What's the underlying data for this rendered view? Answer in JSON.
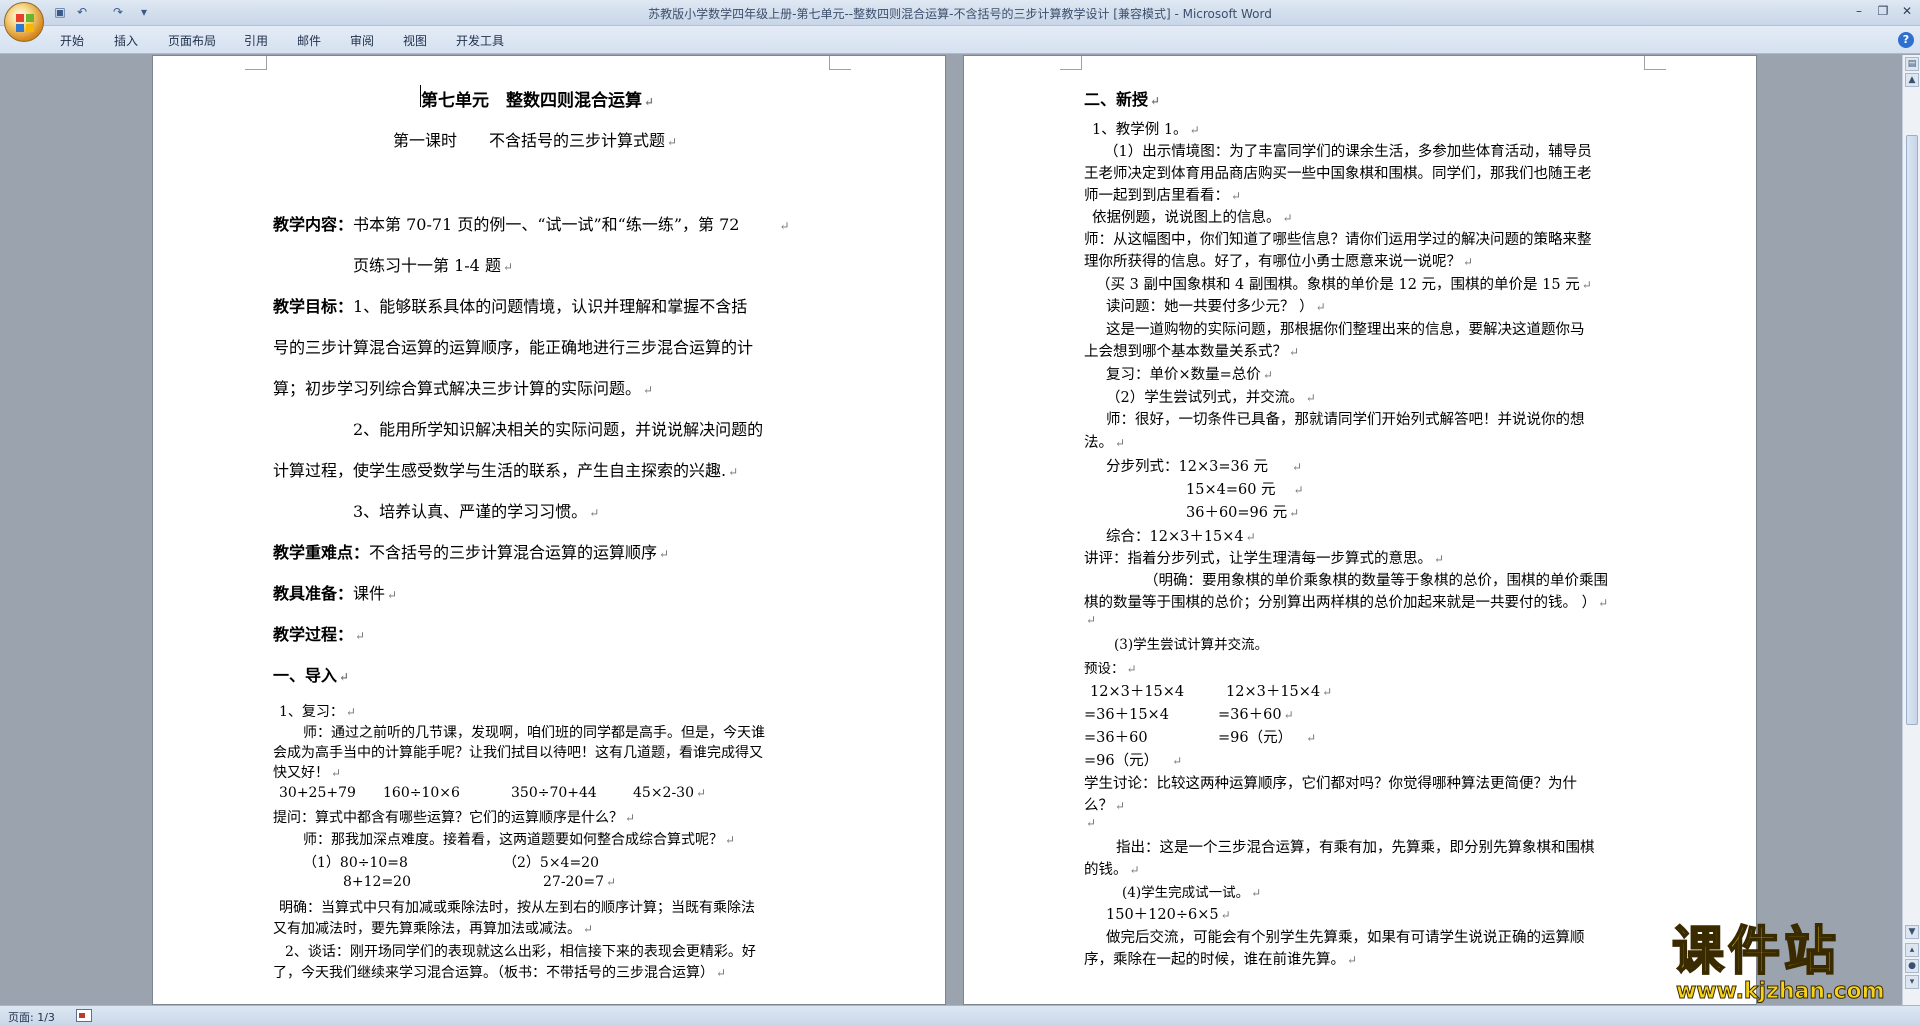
{
  "window": {
    "title": "苏教版小学数学四年级上册-第七单元--整数四则混合运算-不含括号的三步计算教学设计 [兼容模式] - Microsoft Word",
    "minimize": "–",
    "restore": "❐",
    "close": "✕"
  },
  "quick_access": {
    "save": "▣",
    "undo": "↶",
    "redo": "↷",
    "customize": "▾"
  },
  "ribbon": {
    "tabs": [
      "开始",
      "插入",
      "页面布局",
      "引用",
      "邮件",
      "审阅",
      "视图",
      "开发工具"
    ],
    "help": "?"
  },
  "page1": {
    "title": "第七单元　整数四则混合运算",
    "subtitle": "第一课时　　不含括号的三步计算式题",
    "content_label": "教学内容：",
    "content_text": "书本第 70-71 页的例一、“试一试”和“练一练”，第 72",
    "content_text2": "页练习十一第 1-4 题",
    "goal_label": "教学目标：",
    "goal_1a": "1、能够联系具体的问题情境，认识并理解和掌握不含括",
    "goal_1b": "号的三步计算混合运算的运算顺序，能正确地进行三步混合运算的计",
    "goal_1c": "算；初步学习列综合算式解决三步计算的实际问题。",
    "goal_2a": "2、能用所学知识解决相关的实际问题，并说说解决问题的",
    "goal_2b": "计算过程，使学生感受数学与生活的联系，产生自主探索的兴趣.",
    "goal_3": "3、培养认真、严谨的学习习惯。",
    "key_label": "教学重难点：",
    "key_text": "不含括号的三步计算混合运算的运算顺序",
    "prep_label": "教具准备：",
    "prep_text": "课件",
    "process_label": "教学过程：",
    "section1": "一、导入",
    "review": "1、复习：",
    "teacher1a": "师：通过之前听的几节课，发现啊，咱们班的同学都是高手。但是，今天谁",
    "teacher1b": "会成为高手当中的计算能手呢？让我们拭目以待吧！这有几道题，看谁完成得又",
    "teacher1c": "快又好！",
    "exercises": [
      "30+25+79",
      "160÷10×6",
      "350÷70+44",
      "45×2-30"
    ],
    "question": "提问：算式中都含有哪些运算？它们的运算顺序是什么？",
    "teacher2": "师：那我加深点难度。接着看，这两道题要如何整合成综合算式呢？",
    "combo_1a": "（1）80÷10=8",
    "combo_2a": "（2）5×4=20",
    "combo_1b": "8+12=20",
    "combo_2b": "27-20=7",
    "clarify_a": "明确：当算式中只有加减或乘除法时，按从左到右的顺序计算；当既有乘除法",
    "clarify_b": "又有加减法时，要先算乘除法，再算加法或减法。",
    "talk_a": "2、谈话：刚开场同学们的表现就这么出彩，相信接下来的表现会更精彩。好",
    "talk_b": "了，今天我们继续来学习混合运算。（板书：不带括号的三步混合运算）"
  },
  "page2": {
    "section2": "二、新授",
    "example": "1、教学例 1。",
    "l1": "（1）出示情境图：为了丰富同学们的课余生活，多参加些体育活动，辅导员",
    "l2": "王老师决定到体育用品商店购买一些中国象棋和围棋。同学们，那我们也随王老",
    "l3": "师一起到到店里看看：",
    "l4": "依据例题，说说图上的信息。",
    "l5": "师：从这幅图中，你们知道了哪些信息？请你们运用学过的解决问题的策略来整",
    "l6": "理你所获得的信息。好了，有哪位小勇士愿意来说一说呢？",
    "l7": "（买 3 副中国象棋和 4 副围棋。象棋的单价是 12 元，围棋的单价是 15 元",
    "l8": "读问题：她一共要付多少元？ ）",
    "l9": "这是一道购物的实际问题，那根据你们整理出来的信息，要解决这道题你马",
    "l10": "上会想到哪个基本数量关系式？",
    "l11": "复习：单价×数量=总价",
    "l12": "（2）学生尝试列式，并交流。",
    "l13": "师：很好，一切条件已具备，那就请同学们开始列式解答吧！并说说你的想",
    "l14": "法。",
    "l15": "分步列式：12×3=36 元",
    "l16": "15×4=60 元",
    "l17": "36＋60=96 元",
    "l18": "综合：12×3＋15×4",
    "l19": "讲评：指着分步列式，让学生理清每一步算式的意思。",
    "l20": "（明确：要用象棋的单价乘象棋的数量等于象棋的总价，围棋的单价乘围",
    "l21": "棋的数量等于围棋的总价；分别算出两样棋的总价加起来就是一共要付的钱。 ）",
    "l22": "(3)学生尝试计算并交流。",
    "l23": "预设：",
    "l24a": "12×3＋15×4",
    "l24b": "12×3＋15×4",
    "l25a": "=36＋15×4",
    "l25b": "=36＋60",
    "l26a": "=36＋60",
    "l26b": "=96（元）",
    "l27": "=96（元）",
    "l28": "学生讨论：比较这两种运算顺序，它们都对吗？你觉得哪种算法更简便？为什",
    "l29": "么？",
    "l30": "指出：这是一个三步混合运算，有乘有加，先算乘，即分别先算象棋和围棋",
    "l31": "的钱。",
    "l32": "(4)学生完成试一试。",
    "l33": "150＋120÷6×5",
    "l34": "做完后交流，可能会有个别学生先算乘，如果有可请学生说说正确的运算顺",
    "l35": "序，乘除在一起的时候，谁在前谁先算。"
  },
  "paragraph_mark": "↵",
  "status": {
    "page": "页面: 1/3"
  },
  "watermark": {
    "cn": "课件站",
    "url": "www.kjzhan.com"
  },
  "colors": {
    "titlebar": "#dfe8f3",
    "workspace": "#9aa3ae",
    "watermark": "#f6d31a"
  }
}
